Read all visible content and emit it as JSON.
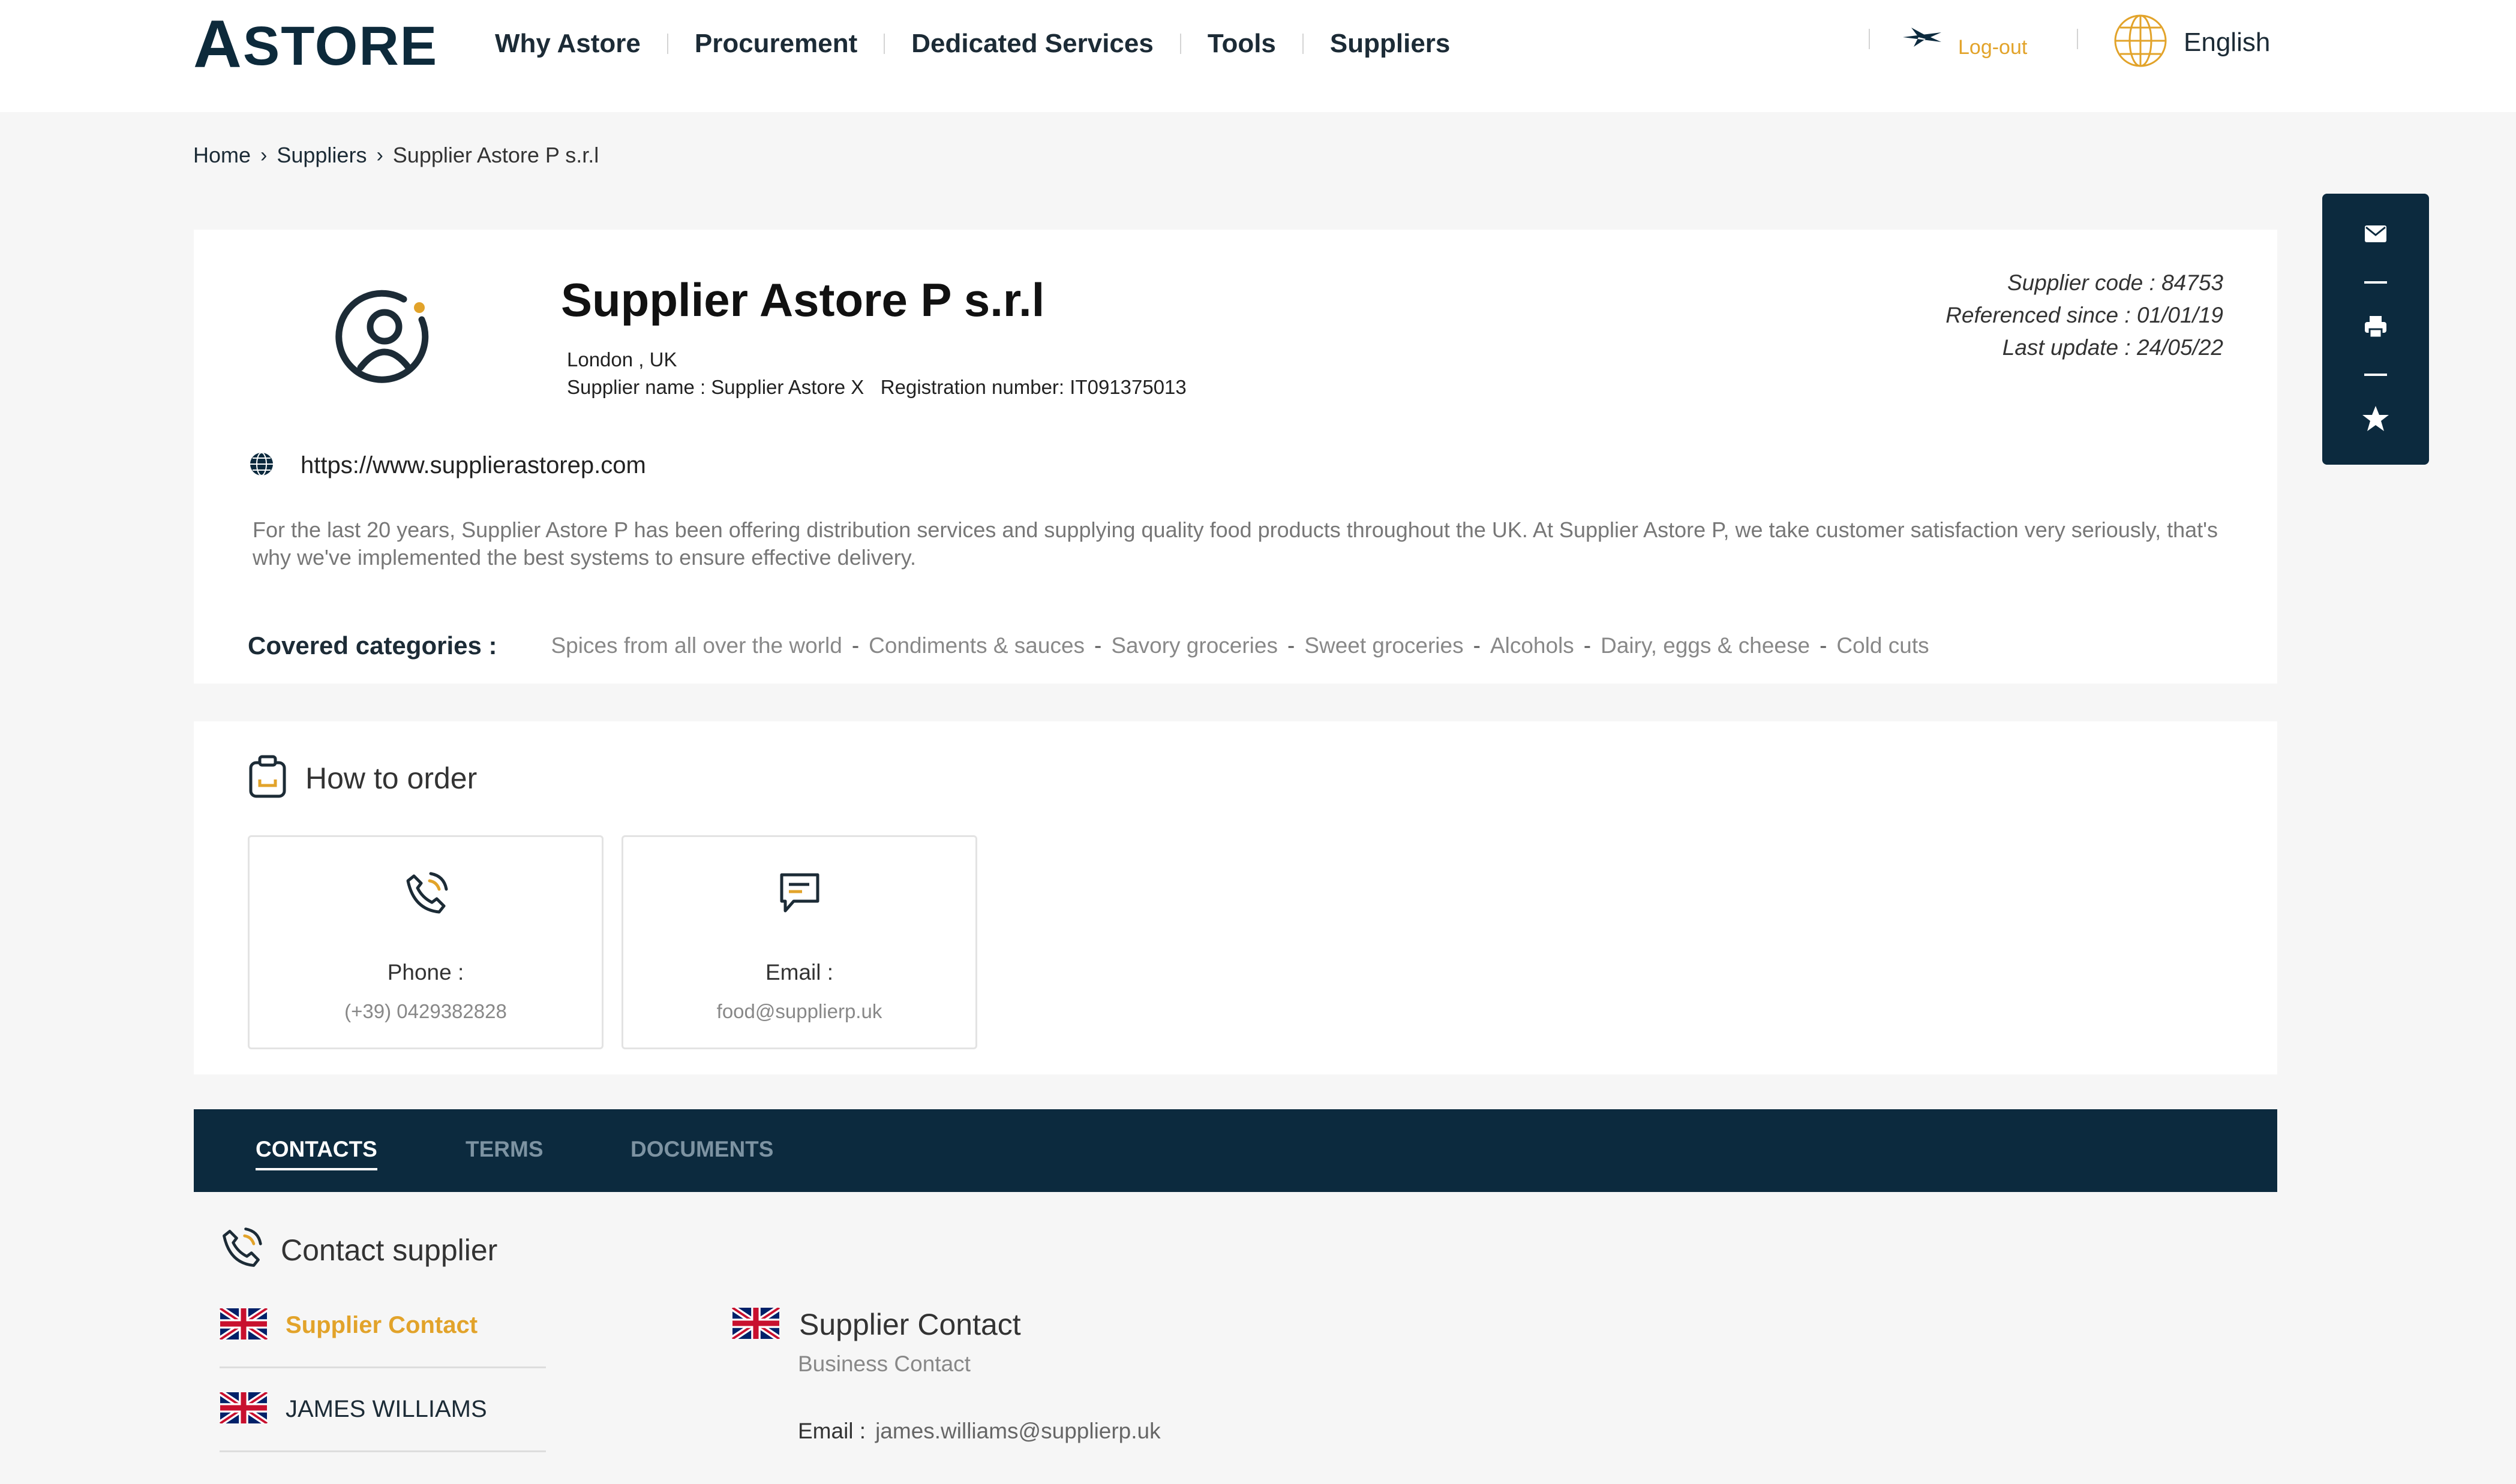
{
  "header": {
    "logo_big": "A",
    "logo_rest": "STORE",
    "nav": [
      {
        "label": "Why Astore"
      },
      {
        "label": "Procurement"
      },
      {
        "label": "Dedicated Services"
      },
      {
        "label": "Tools"
      },
      {
        "label": "Suppliers"
      }
    ],
    "logout_label": "Log-out",
    "language": "English"
  },
  "breadcrumb": {
    "home": "Home",
    "suppliers": "Suppliers",
    "current": "Supplier Astore P s.r.l"
  },
  "supplier": {
    "title": "Supplier Astore P s.r.l",
    "location": "London , UK",
    "meta_line": "Supplier name : Supplier Astore X   Registration number: IT091375013",
    "code": "Supplier code : 84753",
    "referenced_since": "Referenced since : 01/01/19",
    "last_update": "Last update : 24/05/22",
    "website": "https://www.supplierastorep.com",
    "description": "For the last 20 years, Supplier Astore P has been offering distribution services and supplying quality food products throughout the UK. At Supplier Astore P, we take customer satisfaction very seriously, that's why we've implemented the best systems to ensure effective delivery.",
    "categories_label": "Covered categories :",
    "categories": [
      "Spices from all over the world",
      "Condiments & sauces",
      "Savory groceries",
      "Sweet groceries",
      "Alcohols",
      "Dairy, eggs & cheese",
      "Cold cuts"
    ],
    "category_separator": "-"
  },
  "order": {
    "title": "How to order",
    "phone_label": "Phone :",
    "phone_value": "(+39)  0429382828",
    "email_label": "Email :",
    "email_value": "food@supplierp.uk"
  },
  "tabs": [
    {
      "label": "CONTACTS",
      "active": true
    },
    {
      "label": "TERMS",
      "active": false
    },
    {
      "label": "DOCUMENTS",
      "active": false
    }
  ],
  "contacts": {
    "title": "Contact supplier",
    "items": [
      {
        "name": "Supplier Contact",
        "active": true
      },
      {
        "name": "JAMES WILLIAMS",
        "active": false
      }
    ],
    "detail": {
      "name": "Supplier Contact",
      "role": "Business Contact",
      "email_label": "Email :",
      "email_value": "james.williams@supplierp.uk"
    }
  },
  "side_toolbar": {
    "buttons": [
      "envelope-icon",
      "printer-icon",
      "star-icon"
    ]
  },
  "colors": {
    "navy": "#0c2a3e",
    "accent": "#e2a32a",
    "background": "#f6f6f6"
  }
}
